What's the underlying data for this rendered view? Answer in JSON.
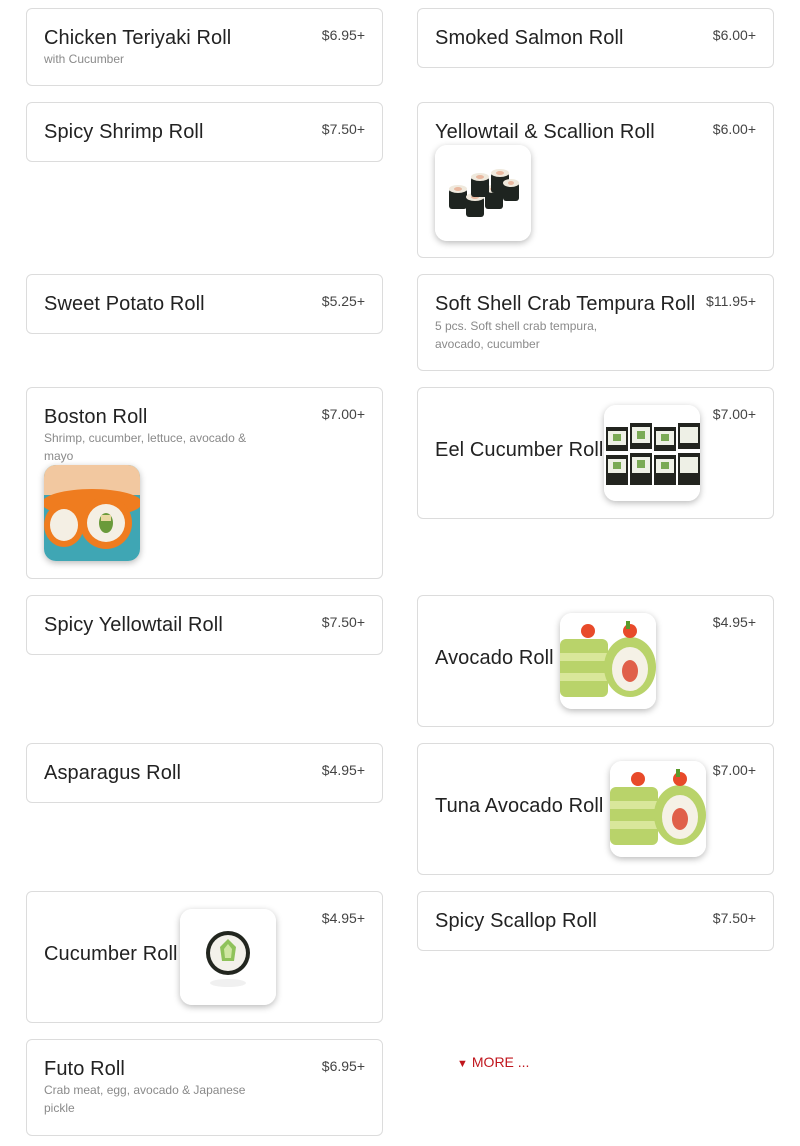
{
  "items": [
    {
      "name": "Chicken Teriyaki Roll",
      "price": "$6.95+",
      "desc": "with Cucumber"
    },
    {
      "name": "Smoked Salmon Roll",
      "price": "$6.00+"
    },
    {
      "name": "Spicy Shrimp Roll",
      "price": "$7.50+"
    },
    {
      "name": "Yellowtail & Scallion Roll",
      "price": "$6.00+",
      "image": "maki-roll-photo"
    },
    {
      "name": "Sweet Potato Roll",
      "price": "$5.25+"
    },
    {
      "name": "Soft Shell Crab Tempura Roll",
      "price": "$11.95+",
      "desc": "5 pcs. Soft shell crab tempura, avocado, cucumber"
    },
    {
      "name": "Boston Roll",
      "price": "$7.00+",
      "desc": "Shrimp, cucumber, lettuce, avocado & mayo",
      "image": "tobiko-roll-photo"
    },
    {
      "name": "Eel Cucumber Roll",
      "price": "$7.00+",
      "image": "maki-rolls-photo"
    },
    {
      "name": "Spicy Yellowtail Roll",
      "price": "$7.50+"
    },
    {
      "name": "Avocado Roll",
      "price": "$4.95+",
      "image": "avocado-roll-photo"
    },
    {
      "name": "Asparagus Roll",
      "price": "$4.95+"
    },
    {
      "name": "Tuna Avocado Roll",
      "price": "$7.00+",
      "image": "avocado-roll-photo"
    },
    {
      "name": "Cucumber Roll",
      "price": "$4.95+",
      "image": "cucumber-roll-photo"
    },
    {
      "name": "Spicy Scallop Roll",
      "price": "$7.50+"
    },
    {
      "name": "Futo Roll",
      "price": "$6.95+",
      "desc": "Crab meat, egg, avocado & Japanese pickle"
    }
  ],
  "more_label": "MORE ...",
  "colors": {
    "accent": "#c0161d",
    "border": "#dcdcdc",
    "text": "#222222",
    "muted": "#8a8a8a"
  }
}
